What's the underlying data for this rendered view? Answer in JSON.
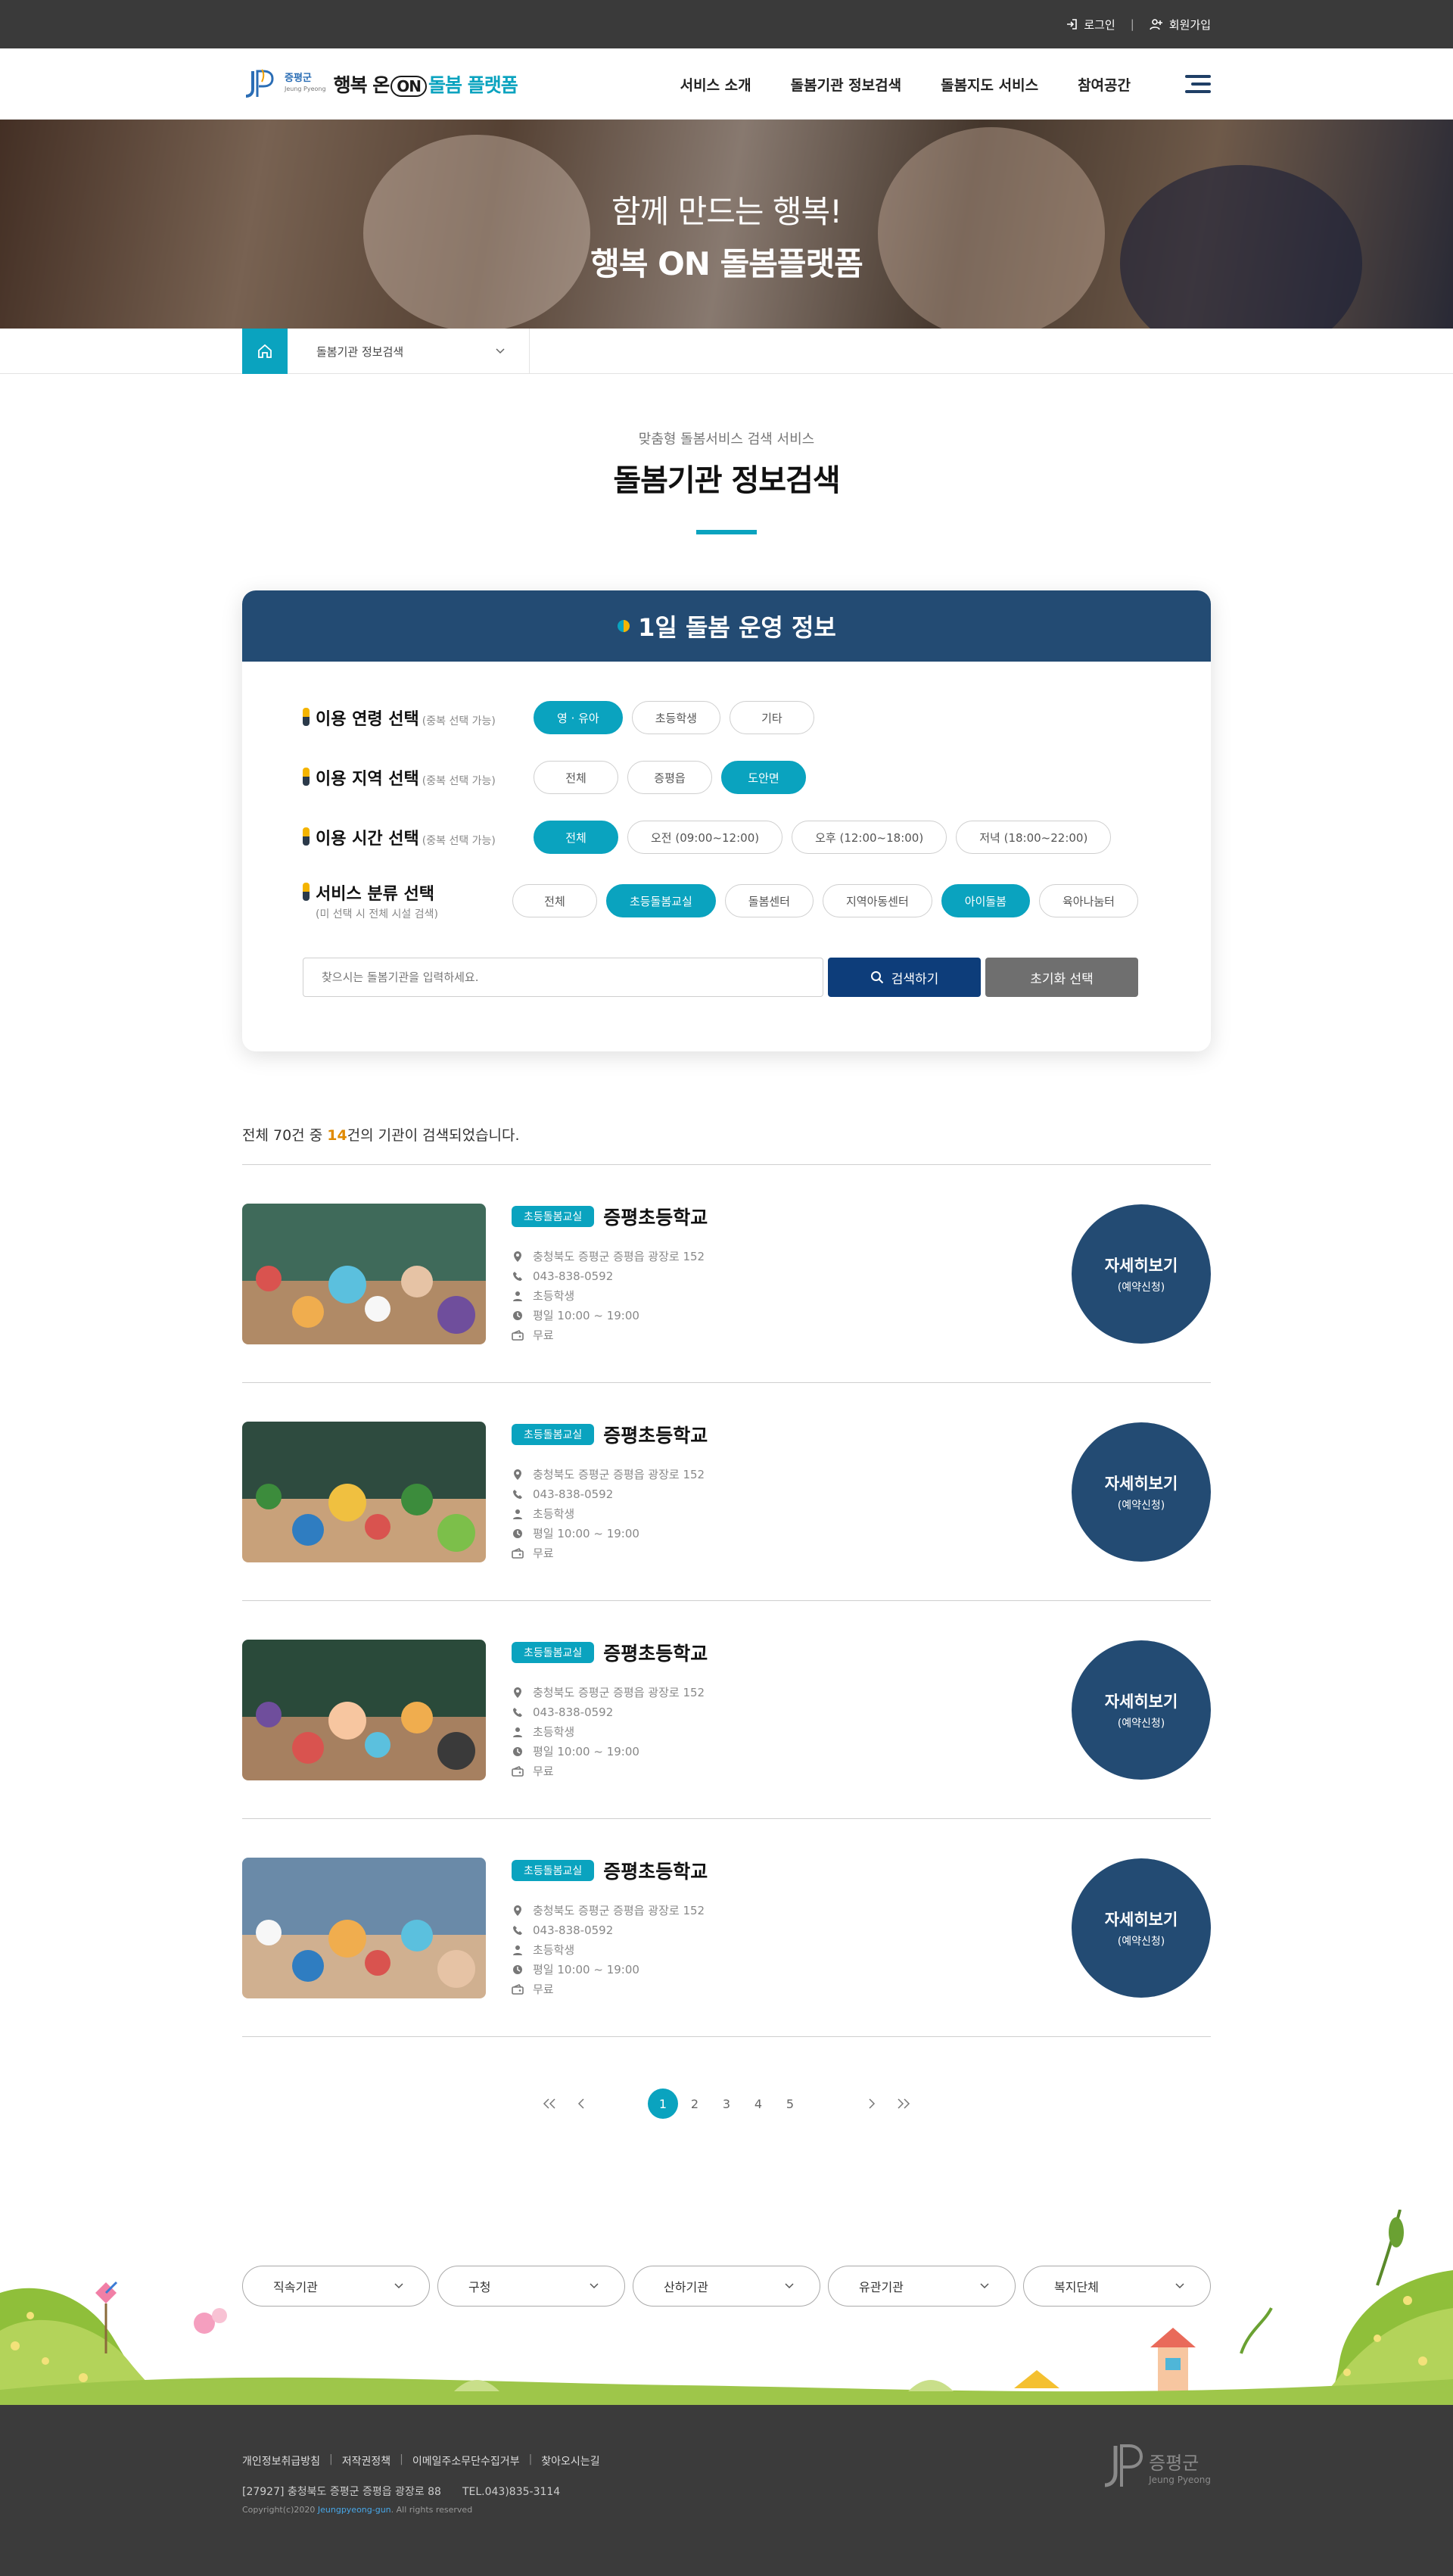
{
  "topbar": {
    "login": "로그인",
    "join": "회원가입",
    "sep": "|"
  },
  "header": {
    "logo_gun": "증평군",
    "logo_gun_en": "Jeung Pyeong",
    "logo_title_a": "행복 온",
    "logo_title_on": "ON",
    "logo_title_b": "돌봄 플랫폼",
    "nav": [
      "서비스 소개",
      "돌봄기관 정보검색",
      "돌봄지도 서비스",
      "참여공간"
    ]
  },
  "hero": {
    "line1": "함께 만드는 행복!",
    "line2": "행복 ON 돌봄플랫폼"
  },
  "breadcrumb": {
    "current": "돌봄기관 정보검색"
  },
  "section": {
    "sub": "맞춤형 돌봄서비스 검색 서비스",
    "title": "돌봄기관 정보검색"
  },
  "filter": {
    "heading": "1일 돌봄 운영 정보",
    "rows": [
      {
        "label": "이용 연령 선택",
        "hint": "(중복 선택 가능)",
        "note": "",
        "options": [
          "영 · 유아",
          "초등학생",
          "기타"
        ],
        "selected": [
          0
        ]
      },
      {
        "label": "이용 지역 선택",
        "hint": "(중복 선택 가능)",
        "note": "",
        "options": [
          "전체",
          "증평읍",
          "도안면"
        ],
        "selected": [
          2
        ]
      },
      {
        "label": "이용 시간 선택",
        "hint": "(중복 선택 가능)",
        "note": "",
        "options": [
          "전체",
          "오전 (09:00~12:00)",
          "오후 (12:00~18:00)",
          "저녁 (18:00~22:00)"
        ],
        "selected": [
          0
        ]
      },
      {
        "label": "서비스 분류 선택",
        "hint": "",
        "note": "(미 선택 시 전체 시설 검색)",
        "options": [
          "전체",
          "초등돌봄교실",
          "돌봄센터",
          "지역아동센터",
          "아이돌봄",
          "육아나눔터"
        ],
        "selected": [
          1,
          4
        ]
      }
    ],
    "search_placeholder": "찾으시는 돌봄기관을 입력하세요.",
    "search_button": "검색하기",
    "reset_button": "초기화 선택"
  },
  "results": {
    "count_prefix": "전체 70건 중 ",
    "count_value": "14",
    "count_suffix": "건의 기관이 검색되었습니다.",
    "items": [
      {
        "badge": "초등돌봄교실",
        "name": "증평초등학교",
        "address": "충청북도 증평군 증평읍 광장로 152",
        "phone": "043-838-0592",
        "target": "초등학생",
        "hours": "평일 10:00 ~ 19:00",
        "fee": "무료",
        "detail": "자세히보기",
        "detail_sub": "(예약신청)"
      },
      {
        "badge": "초등돌봄교실",
        "name": "증평초등학교",
        "address": "충청북도 증평군 증평읍 광장로 152",
        "phone": "043-838-0592",
        "target": "초등학생",
        "hours": "평일 10:00 ~ 19:00",
        "fee": "무료",
        "detail": "자세히보기",
        "detail_sub": "(예약신청)"
      },
      {
        "badge": "초등돌봄교실",
        "name": "증평초등학교",
        "address": "충청북도 증평군 증평읍 광장로 152",
        "phone": "043-838-0592",
        "target": "초등학생",
        "hours": "평일 10:00 ~ 19:00",
        "fee": "무료",
        "detail": "자세히보기",
        "detail_sub": "(예약신청)"
      },
      {
        "badge": "초등돌봄교실",
        "name": "증평초등학교",
        "address": "충청북도 증평군 증평읍 광장로 152",
        "phone": "043-838-0592",
        "target": "초등학생",
        "hours": "평일 10:00 ~ 19:00",
        "fee": "무료",
        "detail": "자세히보기",
        "detail_sub": "(예약신청)"
      }
    ]
  },
  "pagination": {
    "pages": [
      "1",
      "2",
      "3",
      "4",
      "5"
    ],
    "current": "1"
  },
  "footer_selects": [
    "직속기관",
    "구청",
    "산하기관",
    "유관기관",
    "복지단체"
  ],
  "footer": {
    "links": [
      "개인정보취급방침",
      "저작권정책",
      "이메일주소무단수집거부",
      "찾아오시는길"
    ],
    "address": "[27927] 충청북도 증평군 증평읍 광장로 88",
    "tel": "TEL.043)835-3114",
    "copy_prefix": "Copyright(c)2020 ",
    "copy_domain": "Jeungpyeong-gun",
    "copy_suffix": ". All rights reserved",
    "logo_ko": "증평군",
    "logo_en": "Jeung Pyeong"
  },
  "colors": {
    "accent": "#0aa3bf",
    "navy": "#234b73",
    "search": "#0d3d7a",
    "highlight": "#e08a00",
    "topbar": "#3a3a3a"
  }
}
